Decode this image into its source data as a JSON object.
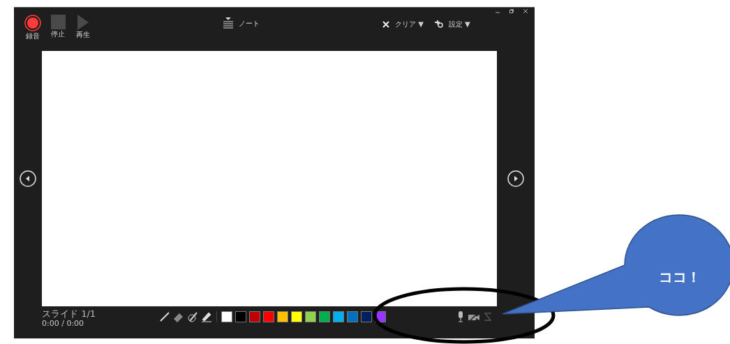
{
  "toolbar": {
    "buttons": [
      {
        "kind": "record",
        "label": "録音"
      },
      {
        "kind": "stop",
        "label": "停止"
      },
      {
        "kind": "play",
        "label": "再生"
      }
    ],
    "notes": "ノート",
    "clear": "クリア ▼",
    "settings": "設定 ▼"
  },
  "status": {
    "slide": "スライド 1/1",
    "time": "0:00 / 0:00"
  },
  "pen_colors": [
    {
      "color": "#ffffff"
    },
    {
      "color": "#000000"
    },
    {
      "color": "#c00000"
    },
    {
      "color": "#ff0000"
    },
    {
      "color": "#ffc000"
    },
    {
      "color": "#ffff00"
    },
    {
      "color": "#92d050"
    },
    {
      "color": "#00b050"
    },
    {
      "color": "#00b0f0"
    },
    {
      "color": "#0070c0"
    },
    {
      "color": "#002060"
    },
    {
      "color": "#9933ff"
    }
  ],
  "callout": {
    "text": "ココ！"
  }
}
